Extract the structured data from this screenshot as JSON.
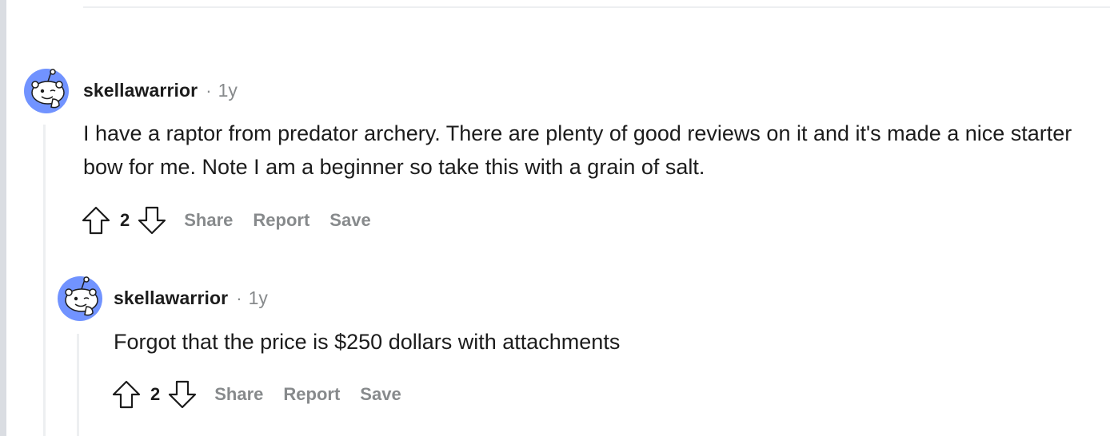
{
  "comments": [
    {
      "author": "skellawarrior",
      "separator": "·",
      "age": "1y",
      "avatar_icon": "reddit-snoo-avatar",
      "body": "I have a raptor from predator archery. There are plenty of good reviews on it and it's made a nice starter bow for me. Note I am a beginner so take this with a grain of salt.",
      "score": "2",
      "actions": {
        "share": "Share",
        "report": "Report",
        "save": "Save"
      }
    },
    {
      "author": "skellawarrior",
      "separator": "·",
      "age": "1y",
      "avatar_icon": "reddit-snoo-avatar",
      "body": "Forgot that the price is $250 dollars with attachments",
      "score": "2",
      "actions": {
        "share": "Share",
        "report": "Report",
        "save": "Save"
      }
    }
  ],
  "colors": {
    "text": "#1c1c1c",
    "meta": "#878a8c",
    "thread_line": "#edeff1",
    "avatar_bg": "#7193ff"
  }
}
